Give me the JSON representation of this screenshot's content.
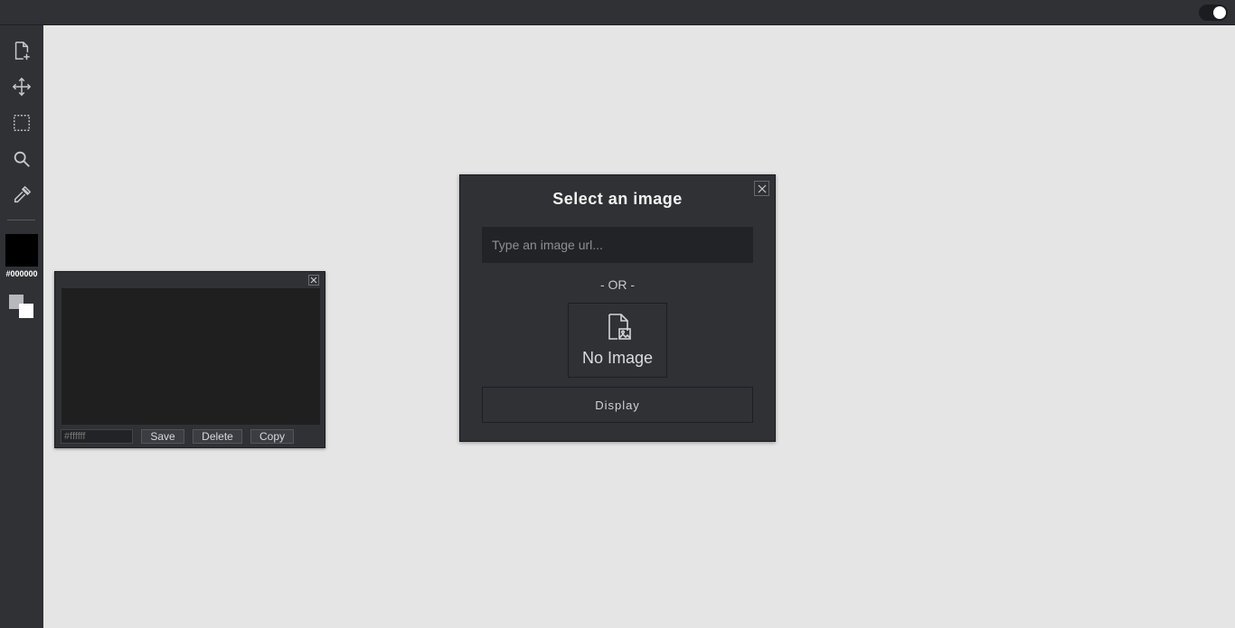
{
  "topbar": {
    "theme_toggle": "on"
  },
  "sidebar": {
    "tools": [
      {
        "name": "new-file",
        "icon": "file-plus-icon"
      },
      {
        "name": "move",
        "icon": "move-arrows-icon"
      },
      {
        "name": "select",
        "icon": "marquee-select-icon"
      },
      {
        "name": "zoom",
        "icon": "magnifier-icon"
      },
      {
        "name": "eyedropper",
        "icon": "eyedropper-icon"
      }
    ],
    "current_color": {
      "hex": "#000000",
      "label": "#000000"
    },
    "secondary_color": "#ffffff"
  },
  "palette_panel": {
    "hex_placeholder": "#ffffff",
    "save_label": "Save",
    "delete_label": "Delete",
    "copy_label": "Copy"
  },
  "image_dialog": {
    "title": "Select an image",
    "url_placeholder": "Type an image url...",
    "url_value": "",
    "or_label": "- OR -",
    "no_image_label": "No Image",
    "display_label": "Display"
  }
}
